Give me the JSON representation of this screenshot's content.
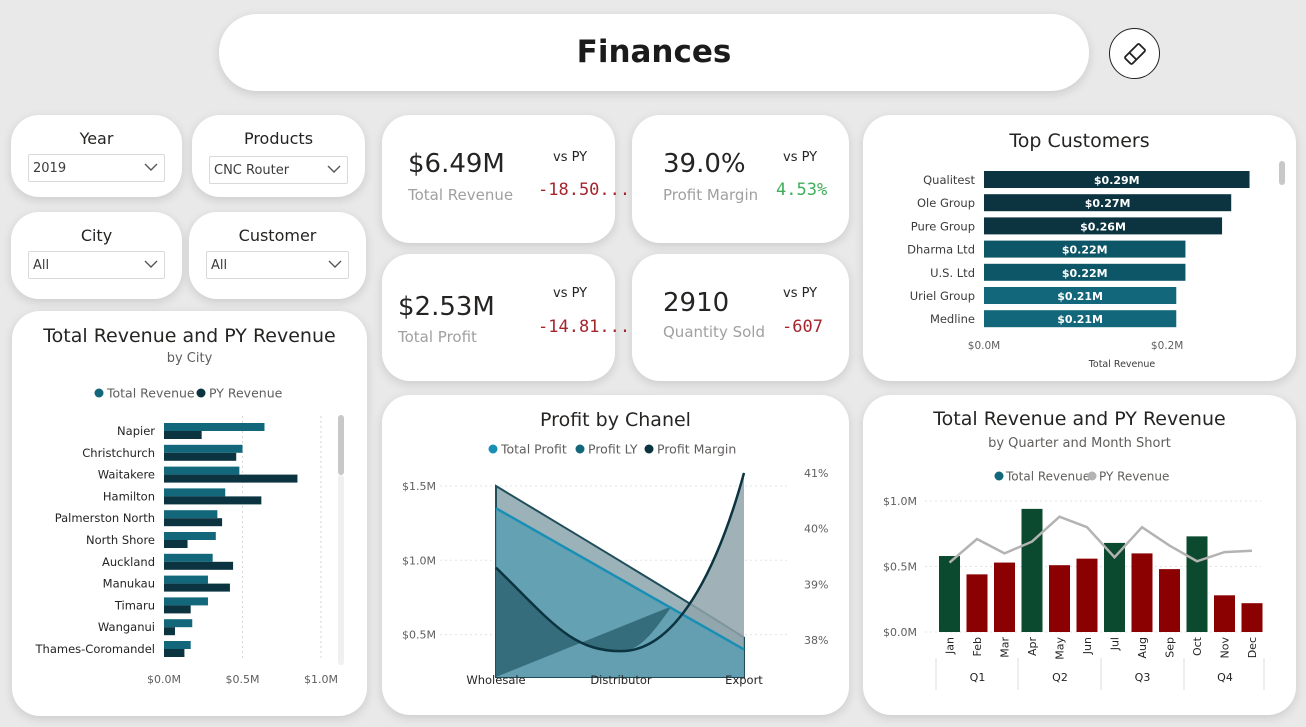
{
  "header": {
    "title": "Finances",
    "clear_filters_icon": "eraser-icon"
  },
  "filters": {
    "year": {
      "label": "Year",
      "value": "2019"
    },
    "products": {
      "label": "Products",
      "value": "CNC Router"
    },
    "city": {
      "label": "City",
      "value": "All"
    },
    "customer": {
      "label": "Customer",
      "value": "All"
    }
  },
  "kpis": {
    "revenue": {
      "value": "$6.49M",
      "label": "Total Revenue",
      "vs": "vs PY",
      "delta": "-18.50...",
      "delta_color": "#a4262c"
    },
    "margin": {
      "value": "39.0%",
      "label": "Profit Margin",
      "vs": "vs PY",
      "delta": "4.53%",
      "delta_color": "#3fae5a"
    },
    "profit": {
      "value": "$2.53M",
      "label": "Total Profit",
      "vs": "vs PY",
      "delta": "-14.81...",
      "delta_color": "#a4262c"
    },
    "quantity": {
      "value": "2910",
      "label": "Quantity Sold",
      "vs": "vs PY",
      "delta": "-607",
      "delta_color": "#a4262c"
    }
  },
  "colors": {
    "dark_teal": "#0f4c5c",
    "teal": "#12677a",
    "navy": "#0b3340",
    "cyan": "#1a8fb5",
    "dark_green": "#0b4a2e",
    "dark_red": "#8b0000",
    "gray": "#b3b3b3"
  },
  "chart_data": [
    {
      "id": "top_customers",
      "type": "bar",
      "title": "Top Customers",
      "xlabel": "Total Revenue",
      "ticks": [
        "$0.0M",
        "$0.2M"
      ],
      "xlim": [
        0,
        0.32
      ],
      "categories": [
        "Qualitest",
        "Ole Group",
        "Pure Group",
        "Dharma Ltd",
        "U.S. Ltd",
        "Uriel Group",
        "Medline"
      ],
      "values": [
        0.29,
        0.27,
        0.26,
        0.22,
        0.22,
        0.21,
        0.21
      ],
      "labels": [
        "$0.29M",
        "$0.27M",
        "$0.26M",
        "$0.22M",
        "$0.22M",
        "$0.21M",
        "$0.21M"
      ]
    },
    {
      "id": "revenue_by_city",
      "type": "bar",
      "title": "Total Revenue and PY Revenue",
      "subtitle": "by City",
      "ticks": [
        "$0.0M",
        "$0.5M",
        "$1.0M"
      ],
      "xlim": [
        0,
        1.0
      ],
      "categories": [
        "Napier",
        "Christchurch",
        "Waitakere",
        "Hamilton",
        "Palmerston North",
        "North Shore",
        "Auckland",
        "Manukau",
        "Timaru",
        "Wanganui",
        "Thames-Coromandel"
      ],
      "series": [
        {
          "name": "Total Revenue",
          "values": [
            0.64,
            0.5,
            0.48,
            0.39,
            0.34,
            0.33,
            0.31,
            0.28,
            0.28,
            0.18,
            0.17
          ]
        },
        {
          "name": "PY Revenue",
          "values": [
            0.24,
            0.46,
            0.85,
            0.62,
            0.37,
            0.15,
            0.44,
            0.42,
            0.17,
            0.07,
            0.13
          ]
        }
      ]
    },
    {
      "id": "profit_by_channel",
      "type": "area",
      "title": "Profit by Chanel",
      "categories": [
        "Wholesale",
        "Distributor",
        "Export"
      ],
      "y_ticks": [
        "$0.5M",
        "$1.0M",
        "$1.5M"
      ],
      "y2_ticks": [
        "38%",
        "39%",
        "40%",
        "41%"
      ],
      "series": [
        {
          "name": "Total Profit",
          "values": [
            1.35,
            0.94,
            0.4
          ]
        },
        {
          "name": "Profit LY",
          "values": [
            1.5,
            0.92,
            0.48
          ]
        },
        {
          "name": "Profit Margin",
          "values": [
            39.3,
            37.8,
            41.0
          ]
        }
      ]
    },
    {
      "id": "revenue_by_month",
      "type": "bar",
      "title": "Total Revenue and PY Revenue",
      "subtitle": "by Quarter and Month Short",
      "y_ticks": [
        "$0.0M",
        "$0.5M",
        "$1.0M"
      ],
      "ylim": [
        0,
        1.05
      ],
      "categories": [
        "Jan",
        "Feb",
        "Mar",
        "Apr",
        "May",
        "Jun",
        "Jul",
        "Aug",
        "Sep",
        "Oct",
        "Nov",
        "Dec"
      ],
      "quarters": [
        "Q1",
        "Q2",
        "Q3",
        "Q4"
      ],
      "series": [
        {
          "name": "Total Revenue",
          "values": [
            0.58,
            0.44,
            0.53,
            0.94,
            0.51,
            0.56,
            0.68,
            0.6,
            0.48,
            0.73,
            0.28,
            0.22
          ]
        },
        {
          "name": "PY Revenue",
          "values": [
            0.53,
            0.71,
            0.6,
            0.69,
            0.88,
            0.8,
            0.57,
            0.8,
            0.66,
            0.54,
            0.61,
            0.62
          ]
        }
      ],
      "above_py_color": "#0b4a2e",
      "below_py_color": "#8b0000"
    }
  ]
}
